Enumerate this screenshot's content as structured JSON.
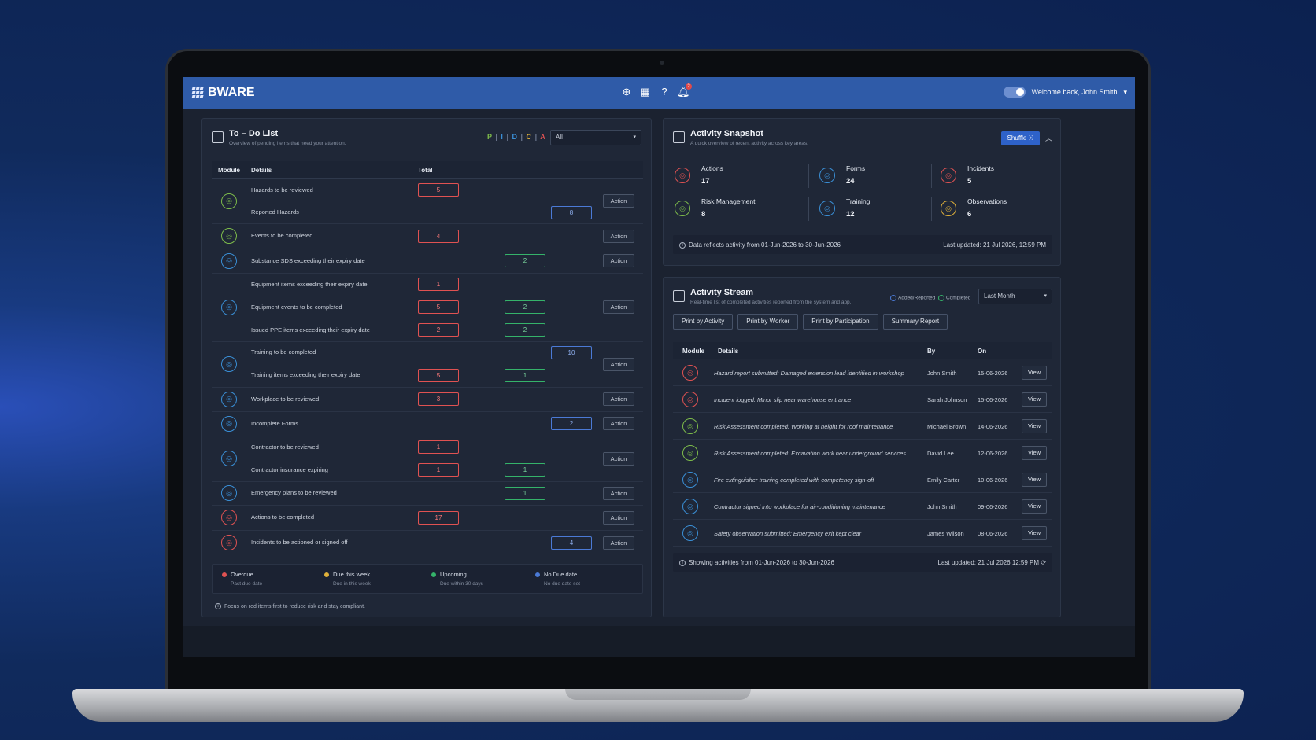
{
  "header": {
    "brand": "BWARE",
    "user_greeting": "Welcome back, John Smith",
    "notification_count": "2"
  },
  "todo": {
    "title": "To – Do List",
    "subtitle": "Overview of pending items that need your attention.",
    "filter_letters": [
      "P",
      "I",
      "D",
      "I",
      "C",
      "I",
      "A"
    ],
    "filter_value": "All",
    "columns": {
      "module": "Module",
      "details": "Details",
      "total": "Total"
    },
    "rows": [
      {
        "detail": "Hazards to be reviewed",
        "red": "5"
      },
      {
        "detail": "Reported Hazards",
        "blue": "8"
      },
      {
        "detail": "Events to be completed",
        "red": "4"
      },
      {
        "detail": "Substance SDS exceeding their expiry date",
        "green": "2"
      },
      {
        "detail": "Equipment items exceeding their expiry date",
        "red": "1"
      },
      {
        "detail": "Equipment events to be completed",
        "red": "5",
        "green": "2"
      },
      {
        "detail": "Issued PPE items exceeding their expiry date",
        "red": "2",
        "green": "2"
      },
      {
        "detail": "Training to be completed",
        "blue": "10"
      },
      {
        "detail": "Training items exceeding their expiry date",
        "red": "5",
        "green": "1"
      },
      {
        "detail": "Workplace to be reviewed",
        "red": "3"
      },
      {
        "detail": "Incomplete Forms",
        "blue": "2"
      },
      {
        "detail": "Contractor to be reviewed",
        "red": "1"
      },
      {
        "detail": "Contractor insurance expiring",
        "red": "1",
        "green": "1"
      },
      {
        "detail": "Emergency plans to be reviewed",
        "green": "1"
      },
      {
        "detail": "Actions to be completed",
        "red": "17"
      },
      {
        "detail": "Incidents to be actioned or signed off",
        "blue": "4"
      }
    ],
    "action_label": "Action",
    "legend": [
      {
        "label": "Overdue",
        "sub": "Past due date",
        "color": "#e05252"
      },
      {
        "label": "Due this week",
        "sub": "Due in this week",
        "color": "#e0b13a"
      },
      {
        "label": "Upcoming",
        "sub": "Due within 30 days",
        "color": "#35b36a"
      },
      {
        "label": "No Due date",
        "sub": "No due date set",
        "color": "#4b7ad6"
      }
    ],
    "footer": "Focus on red items first to reduce risk and stay compliant."
  },
  "snapshot": {
    "title": "Activity Snapshot",
    "subtitle": "A quick overview of recent activity across key areas.",
    "shuffle_label": "Shuffle",
    "stats": [
      {
        "label": "Actions",
        "value": "17",
        "color": "#e05252",
        "icon": "rocket-icon"
      },
      {
        "label": "Forms",
        "value": "24",
        "color": "#3a8fd6",
        "icon": "form-icon"
      },
      {
        "label": "Incidents",
        "value": "5",
        "color": "#e05252",
        "icon": "incident-icon"
      },
      {
        "label": "Risk Management",
        "value": "8",
        "color": "#7dbb4a",
        "icon": "risk-icon"
      },
      {
        "label": "Training",
        "value": "12",
        "color": "#3a8fd6",
        "icon": "training-icon"
      },
      {
        "label": "Observations",
        "value": "6",
        "color": "#e0b13a",
        "icon": "observation-icon"
      }
    ],
    "footer_left": "Data reflects activity from 01-Jun-2026 to 30-Jun-2026",
    "footer_right": "Last updated: 21 Jul 2026, 12:59 PM"
  },
  "stream": {
    "title": "Activity Stream",
    "subtitle": "Real-time list of completed activities reported from the system and app.",
    "legend_added": "Added/Reported",
    "legend_completed": "Completed",
    "filter_value": "Last Month",
    "buttons": [
      "Print by Activity",
      "Print by Worker",
      "Print by Participation",
      "Summary Report"
    ],
    "columns": {
      "module": "Module",
      "details": "Details",
      "by": "By",
      "on": "On"
    },
    "rows": [
      {
        "detail": "Hazard report submitted: Damaged extension lead identified in workshop",
        "by": "John Smith",
        "on": "15-06-2026",
        "color": "#e05252"
      },
      {
        "detail": "Incident logged: Minor slip near warehouse entrance",
        "by": "Sarah Johnson",
        "on": "15-06-2026",
        "color": "#e05252"
      },
      {
        "detail": "Risk Assessment completed: Working at height for roof maintenance",
        "by": "Michael Brown",
        "on": "14-06-2026",
        "color": "#7dbb4a"
      },
      {
        "detail": "Risk Assessment completed: Excavation work near underground services",
        "by": "David Lee",
        "on": "12-06-2026",
        "color": "#7dbb4a"
      },
      {
        "detail": "Fire extinguisher training completed with competency sign-off",
        "by": "Emily Carter",
        "on": "10-06-2026",
        "color": "#3a8fd6"
      },
      {
        "detail": "Contractor signed into workplace for air-conditioning maintenance",
        "by": "John Smith",
        "on": "09-06-2026",
        "color": "#3a8fd6"
      },
      {
        "detail": "Safety observation submitted: Emergency exit kept clear",
        "by": "James Wilson",
        "on": "08-06-2026",
        "color": "#3a8fd6"
      }
    ],
    "view_label": "View",
    "footer_left": "Showing activities from 01-Jun-2026 to 30-Jun-2026",
    "footer_right": "Last updated: 21 Jul 2026 12:59 PM"
  }
}
